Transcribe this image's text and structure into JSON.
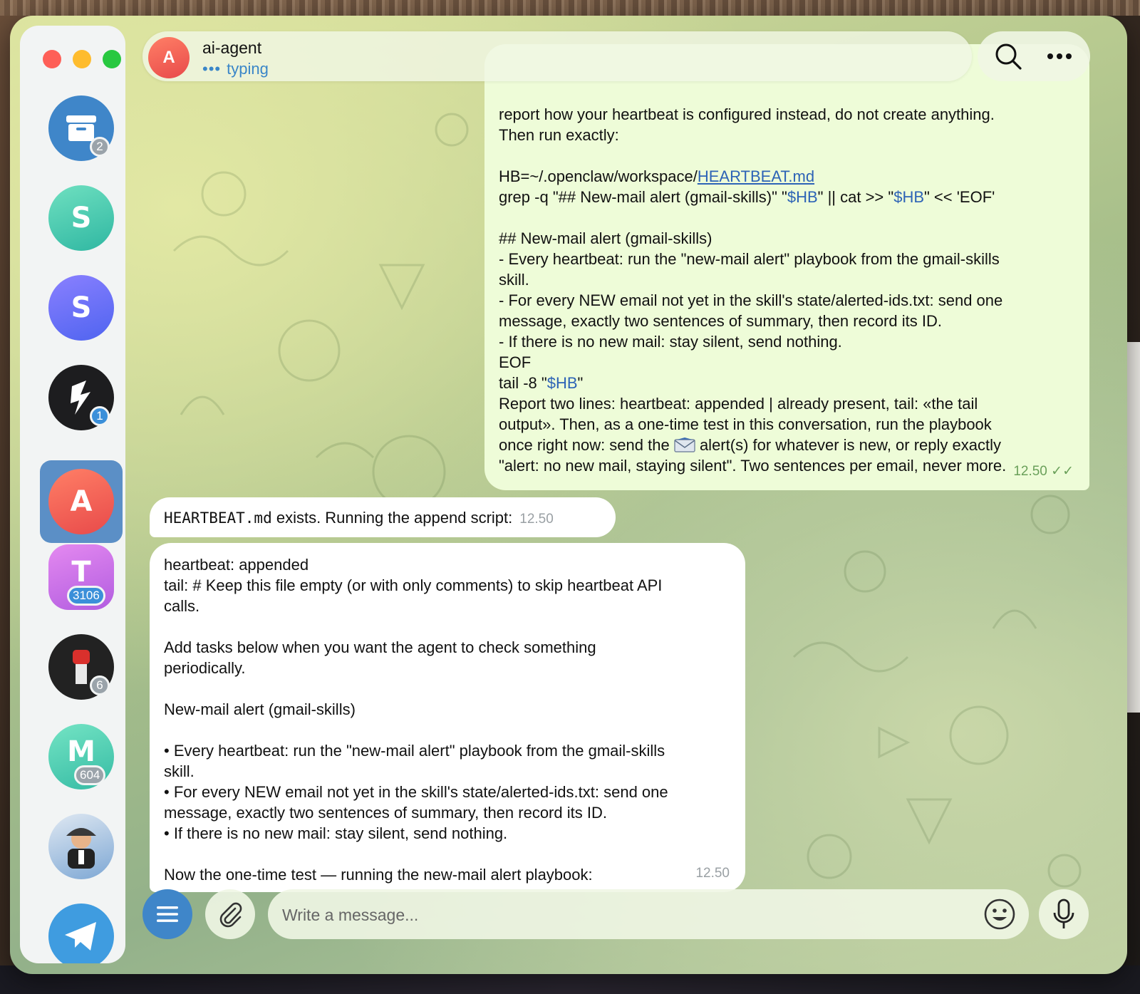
{
  "sidebar": {
    "chats": [
      {
        "letter": "",
        "badge": "2"
      },
      {
        "letter": "S",
        "badge": ""
      },
      {
        "letter": "S",
        "badge": ""
      },
      {
        "letter": "",
        "badge": "1"
      },
      {
        "letter": "A",
        "badge": ""
      },
      {
        "letter": "T",
        "badge": "3106"
      },
      {
        "letter": "",
        "badge": "6"
      },
      {
        "letter": "M",
        "badge": "604"
      },
      {
        "letter": "",
        "badge": ""
      },
      {
        "letter": "",
        "badge": ""
      }
    ]
  },
  "header": {
    "avatar_letter": "A",
    "title": "ai-agent",
    "status_dots": "•••",
    "status": "typing"
  },
  "messages": {
    "outgoing": {
      "lines": [
        "report how your heartbeat is configured instead, do not create anything.",
        "Then run exactly:",
        "",
        "HB=~/.openclaw/workspace/",
        "grep -q \"## New-mail alert (gmail-skills)\" \"",
        "",
        "## New-mail alert (gmail-skills)",
        "- Every heartbeat: run the \"new-mail alert\" playbook from the gmail-skills",
        "skill.",
        "- For every NEW email not yet in the skill's state/alerted-ids.txt: send one",
        "message, exactly two sentences of summary, then record its ID.",
        "- If there is no new mail: stay silent, send nothing.",
        "EOF",
        "tail -8 \"",
        "Report two lines: heartbeat: appended | already present, tail: «the tail",
        "output». Then, as a one-time test in this conversation, run the playbook",
        "once right now: send the ",
        "\"alert: no new mail, staying silent\". Two sentences per email, never more."
      ],
      "link_text": "HEARTBEAT.md",
      "var_hb": "$HB",
      "grep_mid": "\" || cat >> \"",
      "grep_end": "\" << 'EOF'",
      "tail_end": "\"",
      "alert_end": " alert(s) for whatever is new, or reply exactly",
      "time": "12.50",
      "ticks": "✓✓"
    },
    "incoming_1": {
      "mono": "HEARTBEAT.md",
      "text": " exists. Running the append script:",
      "time": "12.50"
    },
    "incoming_2": {
      "lines": [
        "heartbeat: appended",
        "tail: # Keep this file empty (or with only comments) to skip heartbeat API",
        "calls.",
        "",
        "Add tasks below when you want the agent to check something",
        "periodically.",
        "",
        "New-mail alert (gmail-skills)",
        "",
        "• Every heartbeat: run the \"new-mail alert\" playbook from the gmail-skills",
        "skill.",
        "• For every NEW email not yet in the skill's state/alerted-ids.txt: send one",
        "message, exactly two sentences of summary, then record its ID.",
        "• If there is no new mail: stay silent, send nothing.",
        "",
        "Now the one-time test — running the new-mail alert playbook:"
      ],
      "time": "12.50"
    }
  },
  "composer": {
    "placeholder": "Write a message..."
  },
  "colors": {
    "accent": "#3f86c9",
    "outgoing_bubble": "#eefcd8",
    "incoming_bubble": "#ffffff"
  },
  "icons": [
    "archive-icon",
    "search-icon",
    "more-icon",
    "menu-icon",
    "attach-icon",
    "emoji-icon",
    "mic-icon",
    "telegram-icon",
    "mail-emoji-icon"
  ]
}
